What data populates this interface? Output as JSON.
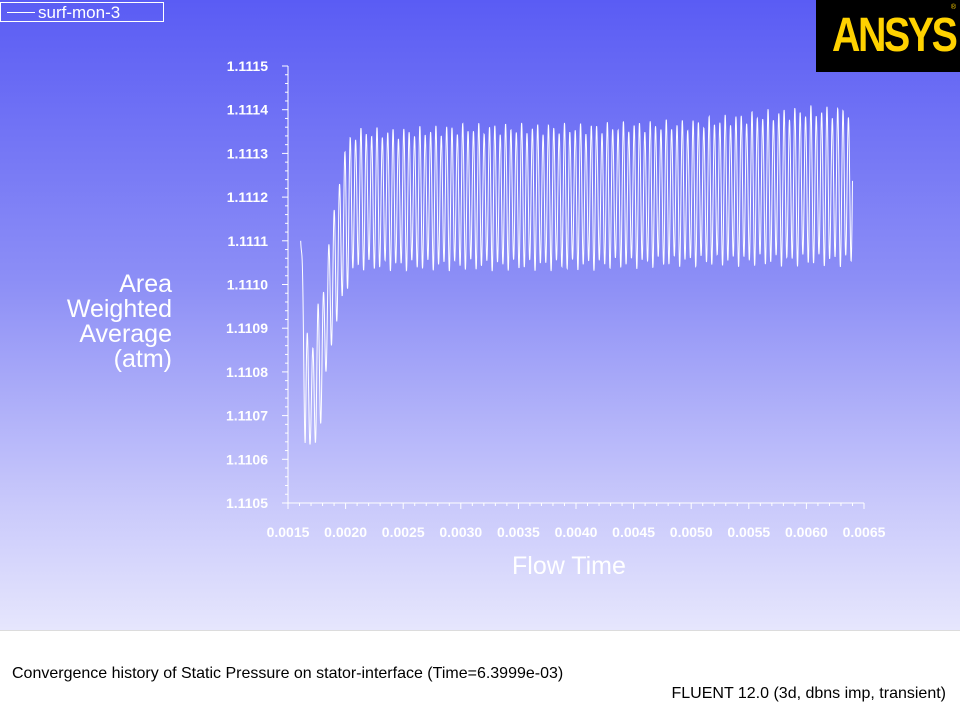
{
  "legend": {
    "series_label": "surf-mon-3"
  },
  "logo": {
    "text": "ANSYS",
    "mark": "®"
  },
  "footer": {
    "caption": "Convergence history of Static Pressure on stator-interface  (Time=6.3999e-03)",
    "version": "FLUENT 12.0 (3d, dbns imp, transient)"
  },
  "colors": {
    "background_top": "#5a5cf4",
    "background_bottom": "#e6e6fd",
    "series": "#ffffff",
    "logo_bg": "#000000",
    "logo_text": "#ffd200"
  },
  "chart_data": {
    "type": "line",
    "xlabel": "Flow Time",
    "ylabel_lines": [
      "Area",
      "Weighted",
      "Average",
      "(atm)"
    ],
    "xlim": [
      0.0015,
      0.0065
    ],
    "ylim": [
      1.1105,
      1.1115
    ],
    "x_ticks": [
      "0.0015",
      "0.0020",
      "0.0025",
      "0.0030",
      "0.0035",
      "0.0040",
      "0.0045",
      "0.0050",
      "0.0055",
      "0.0060",
      "0.0065"
    ],
    "y_ticks": [
      "1.1115",
      "1.1114",
      "1.1113",
      "1.1112",
      "1.1111",
      "1.1110",
      "1.1109",
      "1.1108",
      "1.1107",
      "1.1106",
      "1.1105"
    ],
    "grid": false,
    "series": [
      {
        "name": "surf-mon-3",
        "x_start": 0.00161,
        "x_end": 0.0064,
        "envelope": [
          [
            0.00161,
            1.11112,
            1.11108
          ],
          [
            0.00165,
            1.11093,
            1.1106
          ],
          [
            0.0017,
            1.11084,
            1.11062
          ],
          [
            0.00175,
            1.11095,
            1.11063
          ],
          [
            0.0018,
            1.11098,
            1.1107
          ],
          [
            0.00185,
            1.1111,
            1.11083
          ],
          [
            0.0019,
            1.11117,
            1.11088
          ],
          [
            0.00195,
            1.11126,
            1.11093
          ],
          [
            0.002,
            1.11132,
            1.11098
          ],
          [
            0.00205,
            1.11135,
            1.11101
          ],
          [
            0.0021,
            1.11136,
            1.11103
          ],
          [
            0.0025,
            1.11136,
            1.11103
          ],
          [
            0.003,
            1.11137,
            1.11103
          ],
          [
            0.004,
            1.11137,
            1.11103
          ],
          [
            0.005,
            1.11138,
            1.11104
          ],
          [
            0.0056,
            1.1114,
            1.11104
          ],
          [
            0.006,
            1.11141,
            1.11104
          ],
          [
            0.0064,
            1.11141,
            1.11104
          ]
        ],
        "period": 4.65e-05
      }
    ]
  }
}
